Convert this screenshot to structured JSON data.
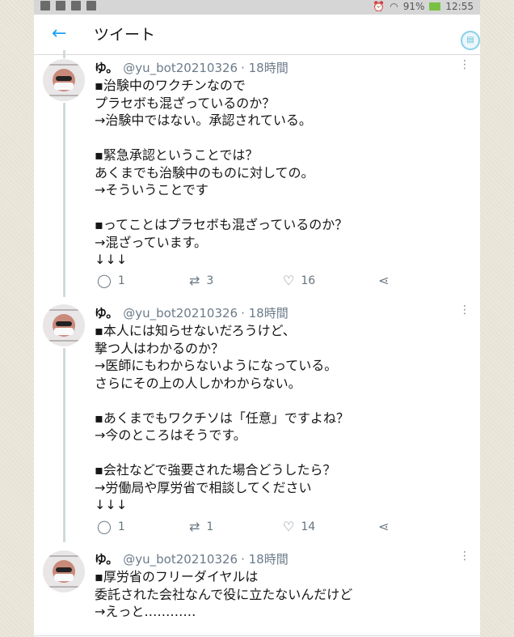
{
  "status_bar": {
    "battery": "91%",
    "time": "12:55"
  },
  "header": {
    "title": "ツイート"
  },
  "tweets": [
    {
      "name": "ゆ。",
      "handle": "@yu_bot20210326",
      "time": "· 18時間",
      "text": "▪治験中のワクチンなので\nプラセボも混ざっているのか？\n→治験中ではない。承認されている。\n\n▪緊急承認ということでは？\nあくまでも治験中のものに対しての。\n→そういうことです\n\n▪ってことはプラセボも混ざっているのか？\n→混ざっています。\n↓↓↓",
      "replies": "1",
      "retweets": "3",
      "likes": "16"
    },
    {
      "name": "ゆ。",
      "handle": "@yu_bot20210326",
      "time": "· 18時間",
      "text": "▪本人には知らせないだろうけど、\n撃つ人はわかるのか？\n→医師にもわからないようになっている。\nさらにその上の人しかわからない。\n\n▪あくまでもワクチソは「任意」ですよね？\n→今のところはそうです。\n\n▪会社などで強要された場合どうしたら？\n→労働局や厚労省で相談してください\n↓↓↓",
      "replies": "1",
      "retweets": "1",
      "likes": "14"
    },
    {
      "name": "ゆ。",
      "handle": "@yu_bot20210326",
      "time": "· 18時間",
      "text": "▪厚労省のフリーダイヤルは\n委託された会社なんで役に立たないんだけど\n→えっと…………"
    }
  ]
}
